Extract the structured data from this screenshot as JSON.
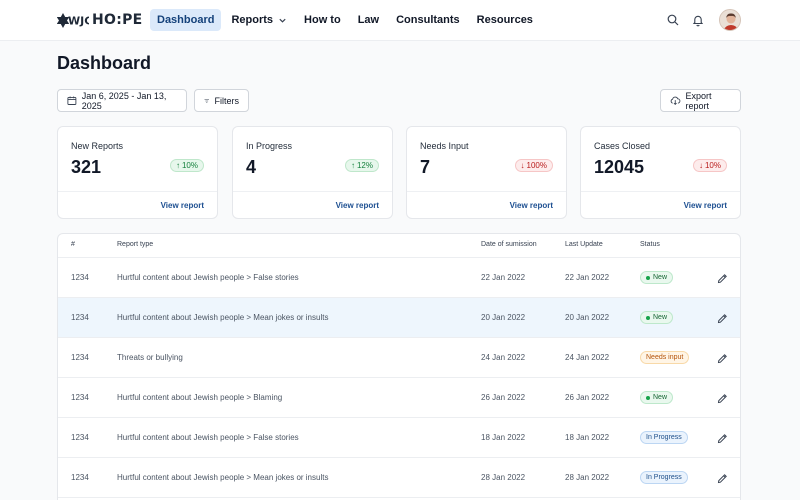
{
  "header": {
    "logo_text": "HO:PE",
    "nav": [
      {
        "label": "Dashboard",
        "active": true
      },
      {
        "label": "Reports",
        "dropdown": true
      },
      {
        "label": "How to"
      },
      {
        "label": "Law"
      },
      {
        "label": "Consultants"
      },
      {
        "label": "Resources"
      }
    ],
    "icons": [
      "search-icon",
      "bell-icon",
      "avatar"
    ]
  },
  "page": {
    "title": "Dashboard",
    "date_range": "Jan 6, 2025 - Jan 13, 2025",
    "filters_label": "Filters",
    "export_label": "Export report"
  },
  "cards": [
    {
      "label": "New Reports",
      "value": "321",
      "trend": "10%",
      "direction": "up",
      "link": "View report"
    },
    {
      "label": "In Progress",
      "value": "4",
      "trend": "12%",
      "direction": "up",
      "link": "View report"
    },
    {
      "label": "Needs Input",
      "value": "7",
      "trend": "100%",
      "direction": "down",
      "link": "View report"
    },
    {
      "label": "Cases Closed",
      "value": "12045",
      "trend": "10%",
      "direction": "down",
      "link": "View report"
    }
  ],
  "table": {
    "headers": {
      "num": "#",
      "type": "Report type",
      "date": "Date of sumission",
      "updated": "Last Update",
      "status": "Status"
    },
    "rows": [
      {
        "num": "1234",
        "type": "Hurtful content about Jewish people > False stories",
        "date": "22 Jan 2022",
        "updated": "22 Jan 2022",
        "status": "New",
        "status_kind": "new"
      },
      {
        "num": "1234",
        "type": "Hurtful content about Jewish people > Mean jokes or insults",
        "date": "20 Jan 2022",
        "updated": "20 Jan 2022",
        "status": "New",
        "status_kind": "new",
        "highlight": true
      },
      {
        "num": "1234",
        "type": "Threats or bullying",
        "date": "24 Jan 2022",
        "updated": "24 Jan 2022",
        "status": "Needs input",
        "status_kind": "needs"
      },
      {
        "num": "1234",
        "type": "Hurtful content about Jewish people > Blaming",
        "date": "26 Jan 2022",
        "updated": "26 Jan 2022",
        "status": "New",
        "status_kind": "new"
      },
      {
        "num": "1234",
        "type": "Hurtful content about Jewish people > False stories",
        "date": "18 Jan 2022",
        "updated": "18 Jan 2022",
        "status": "In Progress",
        "status_kind": "progress"
      },
      {
        "num": "1234",
        "type": "Hurtful content about Jewish people > Mean jokes or insults",
        "date": "28 Jan 2022",
        "updated": "28 Jan 2022",
        "status": "In Progress",
        "status_kind": "progress"
      }
    ]
  },
  "colors": {
    "accent": "#14417a",
    "nav_active_bg": "#dbe9fa",
    "link": "#1d4f91",
    "row_highlight": "#eef6fd"
  }
}
